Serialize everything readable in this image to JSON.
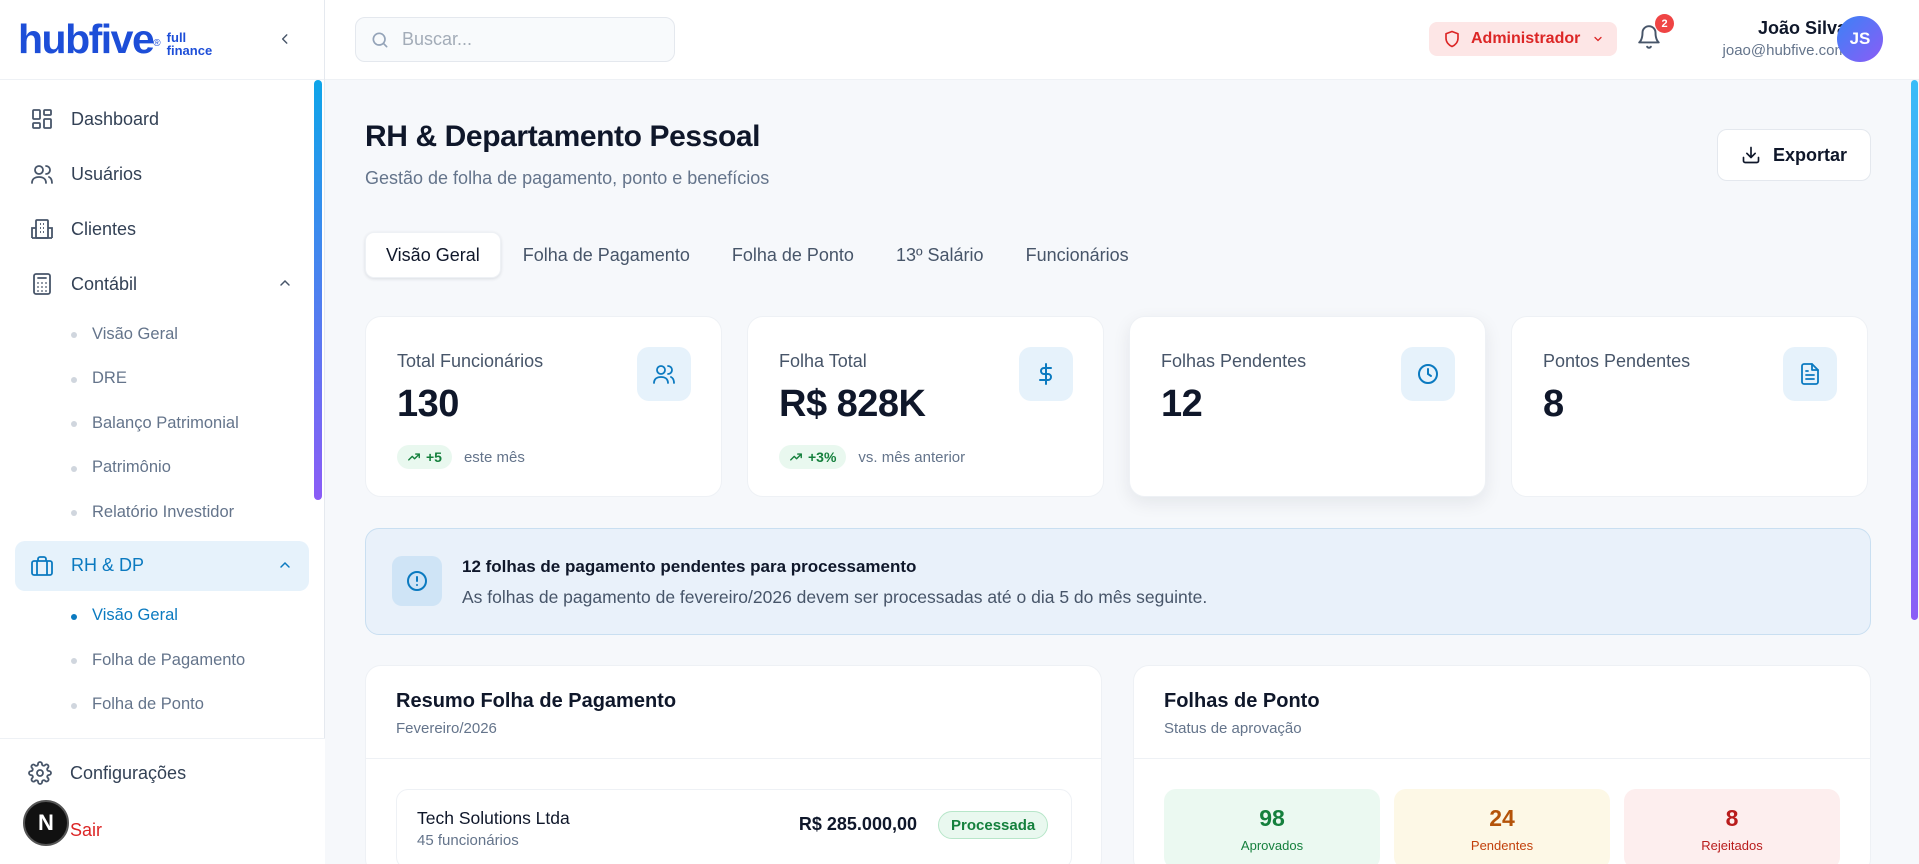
{
  "brand": {
    "name": "hubfive",
    "reg": "®",
    "sub_line1": "full",
    "sub_line2": "finance"
  },
  "sidebar": {
    "items": [
      {
        "label": "Dashboard"
      },
      {
        "label": "Usuários"
      },
      {
        "label": "Clientes"
      },
      {
        "label": "Contábil",
        "expanded": true,
        "children": [
          "Visão Geral",
          "DRE",
          "Balanço Patrimonial",
          "Patrimônio",
          "Relatório Investidor"
        ]
      },
      {
        "label": "RH & DP",
        "active": true,
        "expanded": true,
        "children": [
          "Visão Geral",
          "Folha de Pagamento",
          "Folha de Ponto"
        ],
        "active_child": "Visão Geral"
      }
    ],
    "settings_label": "Configurações",
    "logout_label": "Sair",
    "badge_letter": "N"
  },
  "topbar": {
    "search_placeholder": "Buscar...",
    "role_label": "Administrador",
    "notification_count": "2",
    "user_name": "João Silva",
    "user_email": "joao@hubfive.com",
    "avatar_initials": "JS"
  },
  "page": {
    "title": "RH & Departamento Pessoal",
    "subtitle": "Gestão de folha de pagamento, ponto e benefícios",
    "export_label": "Exportar"
  },
  "tabs": [
    "Visão Geral",
    "Folha de Pagamento",
    "Folha de Ponto",
    "13º Salário",
    "Funcionários"
  ],
  "active_tab": "Visão Geral",
  "stats": [
    {
      "label": "Total Funcionários",
      "value": "130",
      "trend": "+5",
      "trend_text": "este mês",
      "icon": "users-icon"
    },
    {
      "label": "Folha Total",
      "value": "R$ 828K",
      "trend": "+3%",
      "trend_text": "vs. mês anterior",
      "icon": "dollar-icon"
    },
    {
      "label": "Folhas Pendentes",
      "value": "12",
      "icon": "clock-icon"
    },
    {
      "label": "Pontos Pendentes",
      "value": "8",
      "icon": "document-icon"
    }
  ],
  "alert": {
    "title": "12 folhas de pagamento pendentes para processamento",
    "description": "As folhas de pagamento de fevereiro/2026 devem ser processadas até o dia 5 do mês seguinte."
  },
  "payroll_summary": {
    "title": "Resumo Folha de Pagamento",
    "subtitle": "Fevereiro/2026",
    "rows": [
      {
        "company": "Tech Solutions Ltda",
        "employees": "45 funcionários",
        "amount": "R$ 285.000,00",
        "status": "Processada"
      }
    ]
  },
  "timesheets": {
    "title": "Folhas de Ponto",
    "subtitle": "Status de aprovação",
    "approved": {
      "value": "98",
      "label": "Aprovados"
    },
    "pending": {
      "value": "24",
      "label": "Pendentes"
    },
    "rejected": {
      "value": "8",
      "label": "Rejeitados"
    }
  },
  "colors": {
    "brand": "#1d4ed8",
    "accent": "#0b7ac0",
    "danger": "#dc2626",
    "success": "#15803d"
  }
}
